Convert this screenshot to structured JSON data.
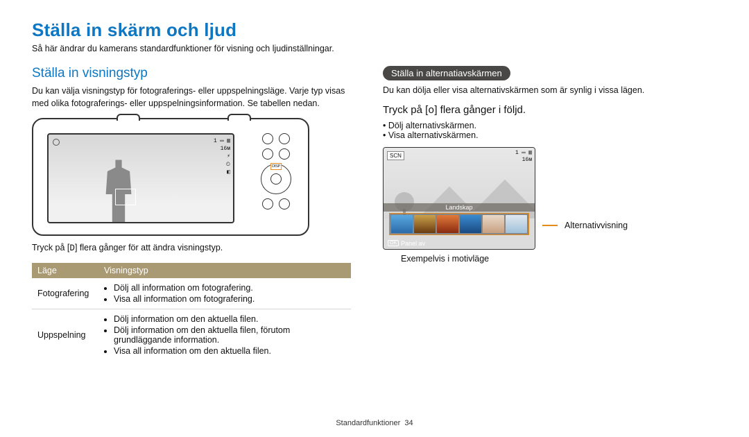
{
  "footer": {
    "label": "Standardfunktioner",
    "page_number": "34"
  },
  "header": {
    "title": "Ställa in skärm och ljud",
    "intro": "Så här ändrar du kamerans standardfunktioner för visning och ljudinställningar."
  },
  "chart_data": {
    "type": "table",
    "columns": [
      "Läge",
      "Visningstyp"
    ],
    "rows": [
      {
        "mode": "Fotografering",
        "items": [
          "Dölj all information om fotografering.",
          "Visa all information om fotografering."
        ]
      },
      {
        "mode": "Uppspelning",
        "items": [
          "Dölj information om den aktuella filen.",
          "Dölj information om den aktuella filen, förutom grundläggande information.",
          "Visa all information om den aktuella filen."
        ]
      }
    ]
  },
  "left": {
    "section_title": "Ställa in visningstyp",
    "section_desc": "Du kan välja visningstyp för fotograferings- eller uppspelningsläge. Varje typ visas med olika fotograferings- eller uppspelningsinformation. Se tabellen nedan.",
    "lcd_indicators": {
      "batt": "1 ▭ ▥",
      "res": "16ᴍ",
      "flash": "⚡",
      "timer": "⏲",
      "other": "◧"
    },
    "disp_label": "DISP",
    "caption_prefix": "Tryck på [",
    "caption_key": "D",
    "caption_suffix": "] flera gånger för att ändra visningstyp.",
    "table_headers": {
      "mode": "Läge",
      "type": "Visningstyp"
    },
    "table_rows": [
      {
        "mode": "Fotografering",
        "items": [
          "Dölj all information om fotografering.",
          "Visa all information om fotografering."
        ]
      },
      {
        "mode": "Uppspelning",
        "items": [
          "Dölj information om den aktuella filen.",
          "Dölj information om den aktuella filen, förutom grundläggande information.",
          "Visa all information om den aktuella filen."
        ]
      }
    ]
  },
  "right": {
    "pill": "Ställa in alternatiavskärmen",
    "desc": "Du kan dölja eller visa alternativskärmen som är synlig i vissa lägen.",
    "instruction_prefix": "Tryck på [",
    "instruction_key": "o",
    "instruction_suffix": "] flera gånger i följd.",
    "bullets": [
      "Dölj alternativskärmen.",
      "Visa alternativskärmen."
    ],
    "example": {
      "scn_label": "SCN",
      "top_right": {
        "batt": "1 ▭ ▥",
        "res": "16ᴍ"
      },
      "mid_label": "Landskap",
      "ok_label": "OK",
      "panel_av": "Panel av",
      "callout": "Alternativvisning"
    },
    "example_caption": "Exempelvis i motivläge"
  }
}
